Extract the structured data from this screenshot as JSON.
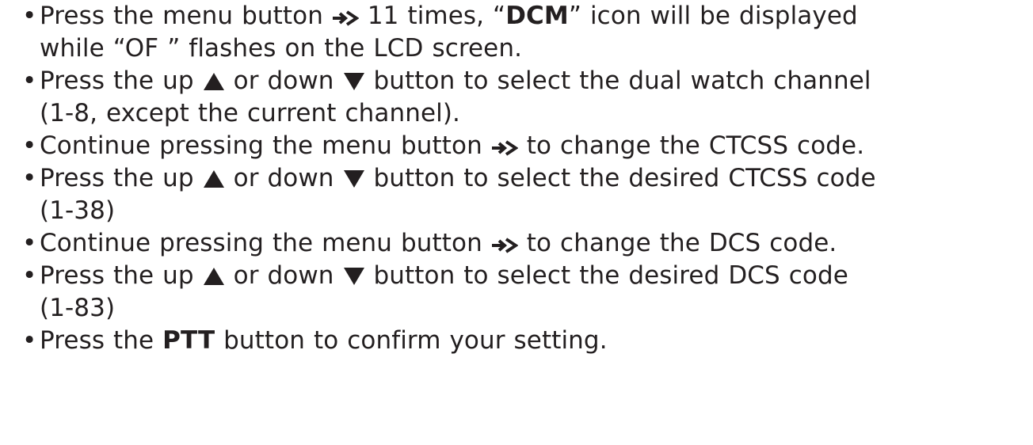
{
  "bullet_glyph": "•",
  "icons": {
    "menu": "menu-arrow-icon",
    "up": "up-triangle-icon",
    "down": "down-triangle-icon"
  },
  "steps": [
    {
      "a": "Press the menu button",
      "b": " 11 times, “",
      "c": "DCM",
      "d": "” icon will be displayed",
      "line2": "while “OF ” flashes on the LCD screen."
    },
    {
      "a": "Press the up",
      "b": " or down",
      "c": " button to select the dual watch channel",
      "line2": "(1-8, except the current channel)."
    },
    {
      "a": "Continue pressing the menu button",
      "b": " to change the CTCSS code."
    },
    {
      "a": "Press the up",
      "b": " or down",
      "c": " button to select the desired CTCSS code",
      "line2": "(1-38)"
    },
    {
      "a": "Continue pressing the menu button",
      "b": " to change the DCS code."
    },
    {
      "a": "Press the up",
      "b": " or down",
      "c": " button to select the desired DCS code",
      "line2": "(1-83)"
    },
    {
      "a": "Press the ",
      "b": "PTT",
      "c": " button to confirm your setting."
    }
  ]
}
